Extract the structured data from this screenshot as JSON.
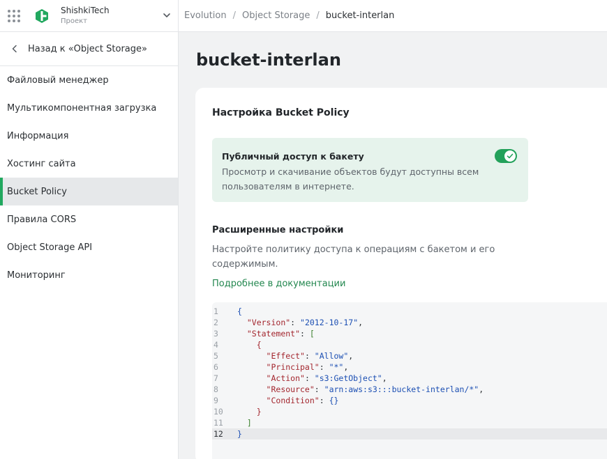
{
  "project": {
    "name": "ShishkiTech",
    "subtitle": "Проект"
  },
  "sidebar": {
    "back_label": "Назад к «Object Storage»",
    "items": [
      {
        "label": "Файловый менеджер"
      },
      {
        "label": "Мультикомпонентная загрузка"
      },
      {
        "label": "Информация"
      },
      {
        "label": "Хостинг сайта"
      },
      {
        "label": "Bucket Policy"
      },
      {
        "label": "Правила CORS"
      },
      {
        "label": "Object Storage API"
      },
      {
        "label": "Мониторинг"
      }
    ],
    "active_index": 4
  },
  "breadcrumb": [
    "Evolution",
    "Object Storage",
    "bucket-interlan"
  ],
  "page_title": "bucket-interlan",
  "policy": {
    "title": "Настройка Bucket Policy",
    "public_access": {
      "title": "Публичный доступ к бакету",
      "description": "Просмотр и скачивание объектов будут доступны всем пользователям в интернете.",
      "enabled": true
    },
    "advanced": {
      "title": "Расширенные настройки",
      "description": "Настройте политику доступа к операциям с бакетом и его содержимым.",
      "docs_link": "Подробнее в документации"
    },
    "code_lines": [
      "{",
      "  \"Version\": \"2012-10-17\",",
      "  \"Statement\": [",
      "    {",
      "      \"Effect\": \"Allow\",",
      "      \"Principal\": \"*\",",
      "      \"Action\": \"s3:GetObject\",",
      "      \"Resource\": \"arn:aws:s3:::bucket-interlan/*\",",
      "      \"Condition\": {}",
      "    }",
      "  ]",
      "}"
    ],
    "current_line": 12
  },
  "colors": {
    "accent": "#23a15a",
    "link": "#23874f",
    "public_bg": "#e6f3ec"
  }
}
